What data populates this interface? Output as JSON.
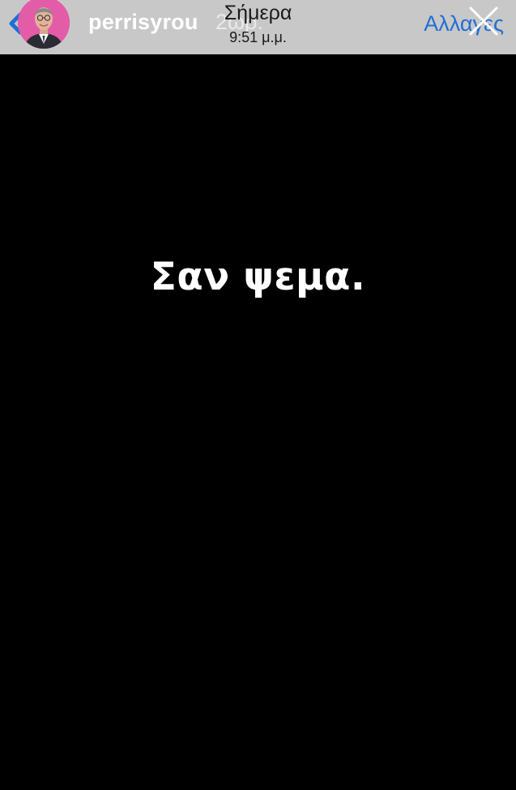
{
  "header": {
    "username": "perrisyrou",
    "time_ago": "2ωρ.",
    "date_title": "Σήμερα",
    "date_time": "9:51 μ.μ.",
    "edit_label": "Αλλαγές",
    "icons": {
      "back": "chevron-left-icon",
      "close": "close-icon",
      "avatar": "profile-photo"
    },
    "colors": {
      "bar_background": "#c8c8c8",
      "accent": "#1f6fd6",
      "avatar_background": "#e25ca7"
    }
  },
  "story": {
    "text": "Σαν ψεμα.",
    "background": "#000000"
  }
}
